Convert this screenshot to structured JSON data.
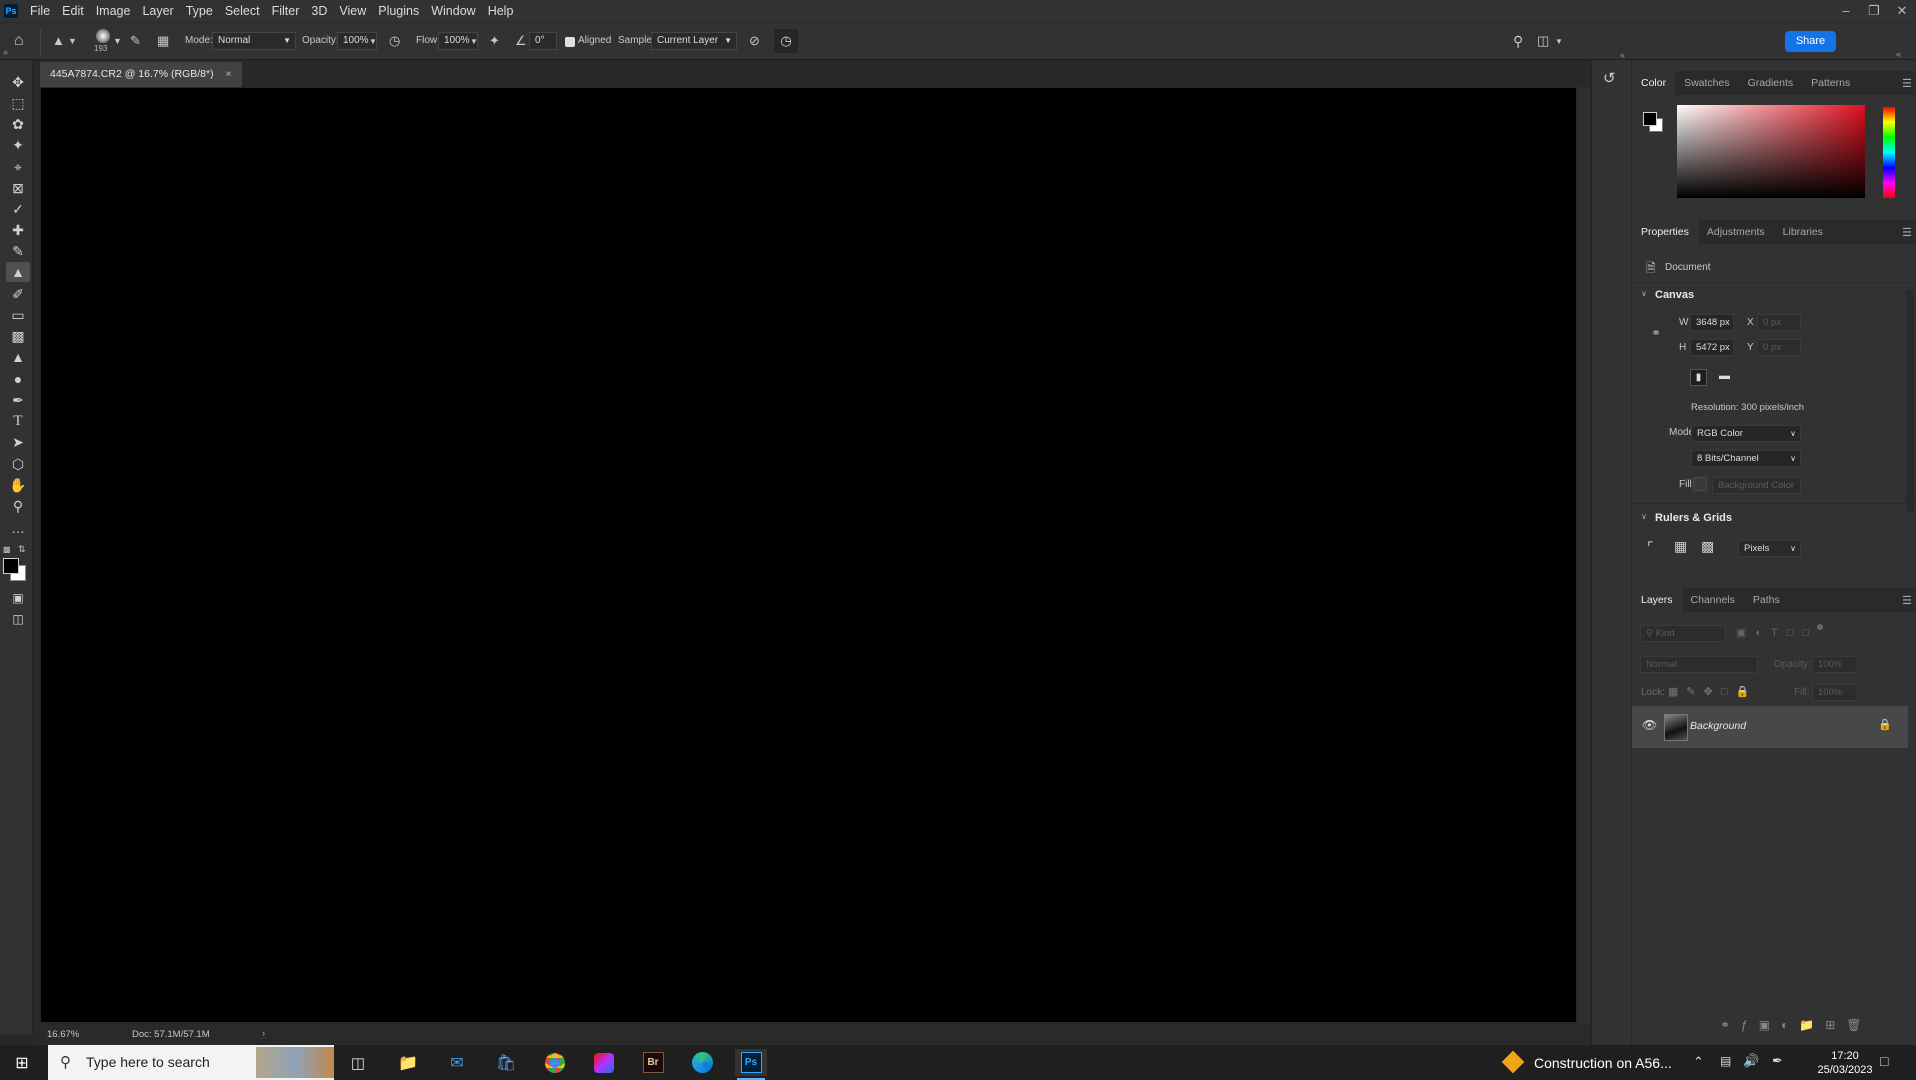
{
  "menubar": {
    "app_logo": "Ps",
    "items": [
      "File",
      "Edit",
      "Image",
      "Layer",
      "Type",
      "Select",
      "Filter",
      "3D",
      "View",
      "Plugins",
      "Window",
      "Help"
    ],
    "window_controls": [
      "minimize-icon",
      "restore-icon",
      "close-icon"
    ]
  },
  "options": {
    "brush_size": "193",
    "mode_label": "Mode:",
    "mode_value": "Normal",
    "opacity_label": "Opacity:",
    "opacity_value": "100%",
    "flow_label": "Flow:",
    "flow_value": "100%",
    "angle_value": "0°",
    "aligned_label": "Aligned",
    "aligned_checked": true,
    "sample_label": "Sample:",
    "sample_value": "Current Layer",
    "share_label": "Share"
  },
  "document": {
    "tab_title": "445A7874.CR2 @ 16.7% (RGB/8*)",
    "zoom": "16.67%",
    "doc_info": "Doc: 57.1M/57.1M"
  },
  "color_panel": {
    "tabs": [
      "Color",
      "Swatches",
      "Gradients",
      "Patterns"
    ],
    "active_tab": "Color",
    "hue_color": "#e0101e"
  },
  "properties_panel": {
    "tabs": [
      "Properties",
      "Adjustments",
      "Libraries"
    ],
    "active_tab": "Properties",
    "doc_label": "Document",
    "canvas_heading": "Canvas",
    "w_label": "W",
    "w_value": "3648 px",
    "h_label": "H",
    "h_value": "5472 px",
    "x_label": "X",
    "x_value": "0 px",
    "y_label": "Y",
    "y_value": "0 px",
    "resolution": "Resolution: 300 pixels/inch",
    "mode_label": "Mode",
    "mode_value": "RGB Color",
    "depth_value": "8 Bits/Channel",
    "fill_label": "Fill",
    "fill_value": "Background Color",
    "rulers_heading": "Rulers & Grids",
    "units_value": "Pixels"
  },
  "layers_panel": {
    "tabs": [
      "Layers",
      "Channels",
      "Paths"
    ],
    "active_tab": "Layers",
    "kind_placeholder": "Kind",
    "blend_value": "Normal",
    "opacity_label": "Opacity:",
    "opacity_value": "100%",
    "lock_label": "Lock:",
    "fill_label": "Fill:",
    "fill_value": "100%",
    "layers": [
      {
        "name": "Background",
        "visible": true,
        "locked": true
      }
    ]
  },
  "taskbar": {
    "search_placeholder": "Type here to search",
    "weather_text": "Construction on A56...",
    "time": "17:20",
    "date": "25/03/2023",
    "apps": [
      "task-view-icon",
      "file-explorer-icon",
      "mail-icon",
      "store-icon",
      "chrome-icon",
      "creative-cloud-icon",
      "bridge-icon",
      "edge-icon",
      "photoshop-icon"
    ],
    "bridge_label": "Br",
    "ps_label": "Ps"
  }
}
